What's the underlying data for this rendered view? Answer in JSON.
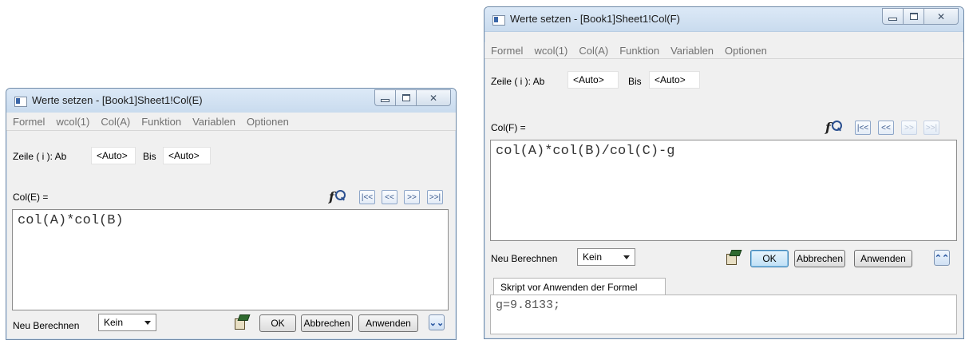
{
  "left_window": {
    "title": "Werte setzen - [Book1]Sheet1!Col(E)",
    "menu": [
      "Formel",
      "wcol(1)",
      "Col(A)",
      "Funktion",
      "Variablen",
      "Optionen"
    ],
    "row_label": "Zeile ( i ): Ab",
    "from_value": "<Auto>",
    "to_label": "Bis",
    "to_value": "<Auto>",
    "col_label": "Col(E) =",
    "formula": "col(A)*col(B)",
    "recalc_label": "Neu Berechnen",
    "recalc_value": "Kein",
    "ok_label": "OK",
    "cancel_label": "Abbrechen",
    "apply_label": "Anwenden",
    "nav": [
      "|<<",
      "<<",
      ">>",
      ">>|"
    ]
  },
  "right_window": {
    "title": "Werte setzen - [Book1]Sheet1!Col(F)",
    "menu": [
      "Formel",
      "wcol(1)",
      "Col(A)",
      "Funktion",
      "Variablen",
      "Optionen"
    ],
    "row_label": "Zeile ( i ): Ab",
    "from_value": "<Auto>",
    "to_label": "Bis",
    "to_value": "<Auto>",
    "col_label": "Col(F) =",
    "formula": "col(A)*col(B)/col(C)-g",
    "recalc_label": "Neu Berechnen",
    "recalc_value": "Kein",
    "ok_label": "OK",
    "cancel_label": "Abbrechen",
    "apply_label": "Anwenden",
    "nav": [
      "|<<",
      "<<",
      ">>",
      ">>|"
    ],
    "script_tab": "Skript vor Anwenden der Formel",
    "script": "g=9.8133;"
  },
  "icons": {
    "function-wizard": "fx-search-icon",
    "collapse": "chevron-double-up-icon",
    "expand": "chevron-double-down-icon",
    "tool": "set-values-tool-icon"
  },
  "colors": {
    "titlebar": "#c9dbee",
    "default_button": "#bfe0f6",
    "menu_text": "#707070"
  }
}
